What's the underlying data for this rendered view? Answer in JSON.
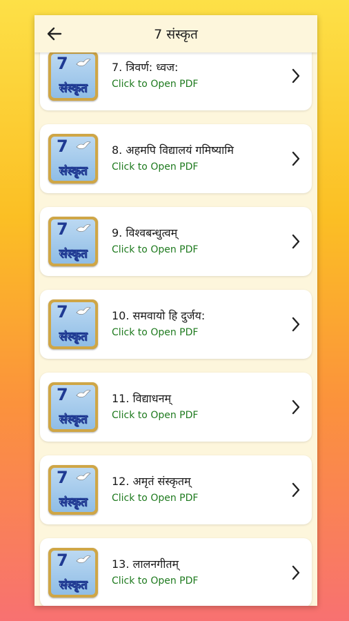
{
  "header": {
    "title": "7 संस्कृत",
    "back_icon": "arrow-left-icon"
  },
  "thumbnail": {
    "number": "7",
    "word": "संस्कृत"
  },
  "items": [
    {
      "title": "7. त्रिवर्ण: ध्वज:",
      "subtitle": "Click to Open PDF"
    },
    {
      "title": "8. अहमपि विद्यालयं गमिष्यामि",
      "subtitle": "Click to Open PDF"
    },
    {
      "title": "9. विश्वबन्धुत्वम्",
      "subtitle": "Click to Open PDF"
    },
    {
      "title": "10. समवायो हि दुर्जय:",
      "subtitle": "Click to Open PDF"
    },
    {
      "title": "11. विद्याधनम्",
      "subtitle": "Click to Open PDF"
    },
    {
      "title": "12. अमृतं संस्कृतम्",
      "subtitle": "Click to Open PDF"
    },
    {
      "title": "13. लालनगीतम्",
      "subtitle": "Click to Open PDF"
    }
  ],
  "colors": {
    "subtitle": "#1e7a1e",
    "thumb_border": "#cfa646",
    "thumb_blue": "#1f3a93"
  }
}
